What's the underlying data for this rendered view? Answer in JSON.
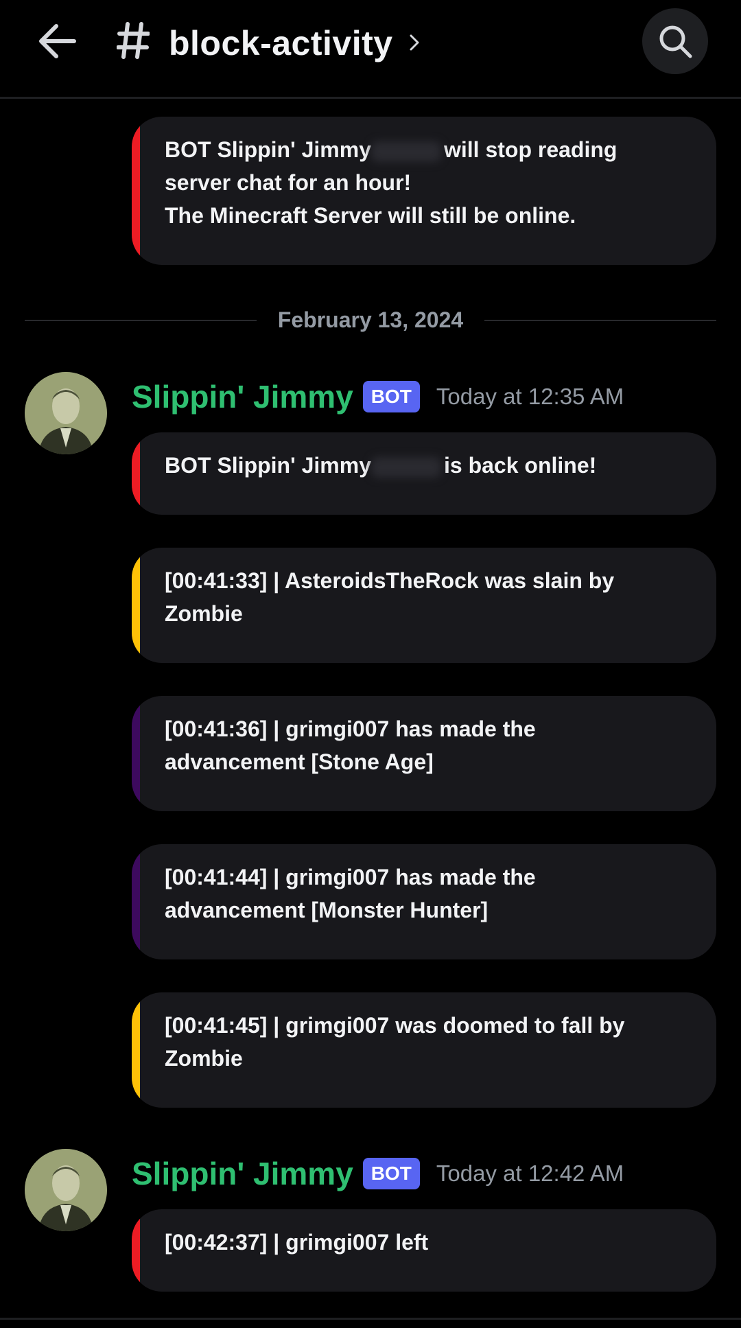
{
  "header": {
    "channel_name": "block-activity",
    "back_icon": "arrow-left-icon",
    "hash_icon": "hash-icon",
    "chevron_icon": "chevron-right-icon",
    "search_icon": "search-icon"
  },
  "messages_top": {
    "embed0": {
      "accent": "#ed1c24",
      "part1": "BOT Slippin' Jimmy",
      "part2": "will stop reading\nserver chat for an hour!\nThe Minecraft Server will still be online."
    }
  },
  "date_divider": "February 13, 2024",
  "group1": {
    "author": "Slippin' Jimmy",
    "badge": "BOT",
    "time": "Today at 12:35 AM",
    "embeds": [
      {
        "accent": "#ed1c24",
        "part1": "BOT Slippin' Jimmy",
        "part2": "is back online!"
      },
      {
        "accent": "#ffc107",
        "text": "[00:41:33] | AsteroidsTheRock was slain by\nZombie"
      },
      {
        "accent": "#3d0a5e",
        "text": "[00:41:36] | grimgi007 has made the\nadvancement [Stone Age]"
      },
      {
        "accent": "#3d0a5e",
        "text": "[00:41:44] | grimgi007 has made the\nadvancement [Monster Hunter]"
      },
      {
        "accent": "#ffc107",
        "text": "[00:41:45] | grimgi007 was doomed to fall by\nZombie"
      }
    ]
  },
  "group2": {
    "author": "Slippin' Jimmy",
    "badge": "BOT",
    "time": "Today at 12:42 AM",
    "embeds": [
      {
        "accent": "#ed1c24",
        "text": "[00:42:37] | grimgi007 left"
      }
    ]
  },
  "colors": {
    "background": "#000000",
    "embed_bg": "#18181c",
    "author_green": "#2fbf71",
    "bot_badge": "#5865f2",
    "muted": "#949ba4"
  }
}
